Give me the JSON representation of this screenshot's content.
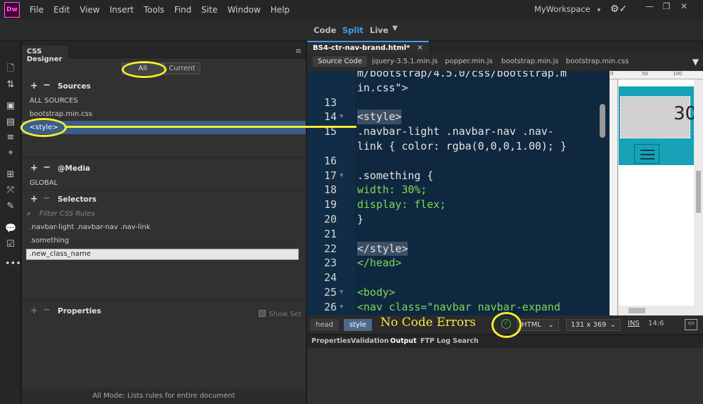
{
  "app": {
    "logo": "Dw"
  },
  "menu": [
    "File",
    "Edit",
    "View",
    "Insert",
    "Tools",
    "Find",
    "Site",
    "Window",
    "Help"
  ],
  "workspace": {
    "name": "MyWorkspace"
  },
  "view_modes": {
    "code": "Code",
    "split": "Split",
    "live": "Live",
    "active": "Split"
  },
  "css_designer": {
    "panel_title": "CSS Designer",
    "toggle": {
      "all": "All",
      "current": "Current",
      "active": "All"
    },
    "sources": {
      "title": "Sources",
      "items": [
        "ALL SOURCES",
        "bootstrap.min.css",
        "<style>"
      ],
      "selected": "<style>"
    },
    "media": {
      "title": "@Media",
      "items": [
        "GLOBAL"
      ]
    },
    "selectors": {
      "title": "Selectors",
      "filter_placeholder": "Filter CSS Rules",
      "items": [
        ".navbar-light .navbar-nav .nav-link",
        ".something"
      ],
      "editing": ".new_class_name"
    },
    "properties": {
      "title": "Properties",
      "show_set": "Show Set"
    },
    "footer": "All Mode: Lists rules for entire document"
  },
  "document": {
    "tab": "BS4-ctr-nav-brand.html*",
    "related_files": [
      "Source Code",
      "jquery-3.5.1.min.js",
      "popper.min.js",
      "bootstrap.min.js",
      "bootstrap.min.css"
    ],
    "code_lines": [
      {
        "n": "",
        "text": "m/bootstrap/4.5.0/css/bootstrap.m"
      },
      {
        "n": "",
        "text": "in.css\">"
      },
      {
        "n": "13",
        "text": ""
      },
      {
        "n": "14",
        "text": "<style>",
        "fold": true
      },
      {
        "n": "15",
        "text": ".navbar-light .navbar-nav .nav-"
      },
      {
        "n": "",
        "text": "link { color: rgba(0,0,0,1.00); }"
      },
      {
        "n": "16",
        "text": ""
      },
      {
        "n": "17",
        "text": ".something {",
        "fold": true
      },
      {
        "n": "18",
        "text": "width: 30%;"
      },
      {
        "n": "19",
        "text": "display: flex;"
      },
      {
        "n": "20",
        "text": "}"
      },
      {
        "n": "21",
        "text": ""
      },
      {
        "n": "22",
        "text": "</style>"
      },
      {
        "n": "23",
        "text": "</head>"
      },
      {
        "n": "24",
        "text": ""
      },
      {
        "n": "25",
        "text": "<body>",
        "fold": true
      },
      {
        "n": "26",
        "text": "<nav class=\"navbar navbar-expand",
        "fold": true
      }
    ],
    "live_preview": {
      "brand_text": "30",
      "ruler_ticks": [
        "0",
        "50",
        "100"
      ]
    },
    "status": {
      "breadcrumbs": [
        "head",
        "style"
      ],
      "message": "No Code Errors",
      "language": "HTML",
      "size": "131 x 369",
      "mode": "INS",
      "position": "14:6"
    },
    "bottom_tabs": [
      "Properties",
      "Validation",
      "Output",
      "FTP Log",
      "Search"
    ],
    "bottom_active": "Output"
  },
  "colors": {
    "accent": "#3ea0f0",
    "annotation": "#f5ec2e",
    "code_bg": "#0f2840",
    "ok": "#3bb34a"
  }
}
